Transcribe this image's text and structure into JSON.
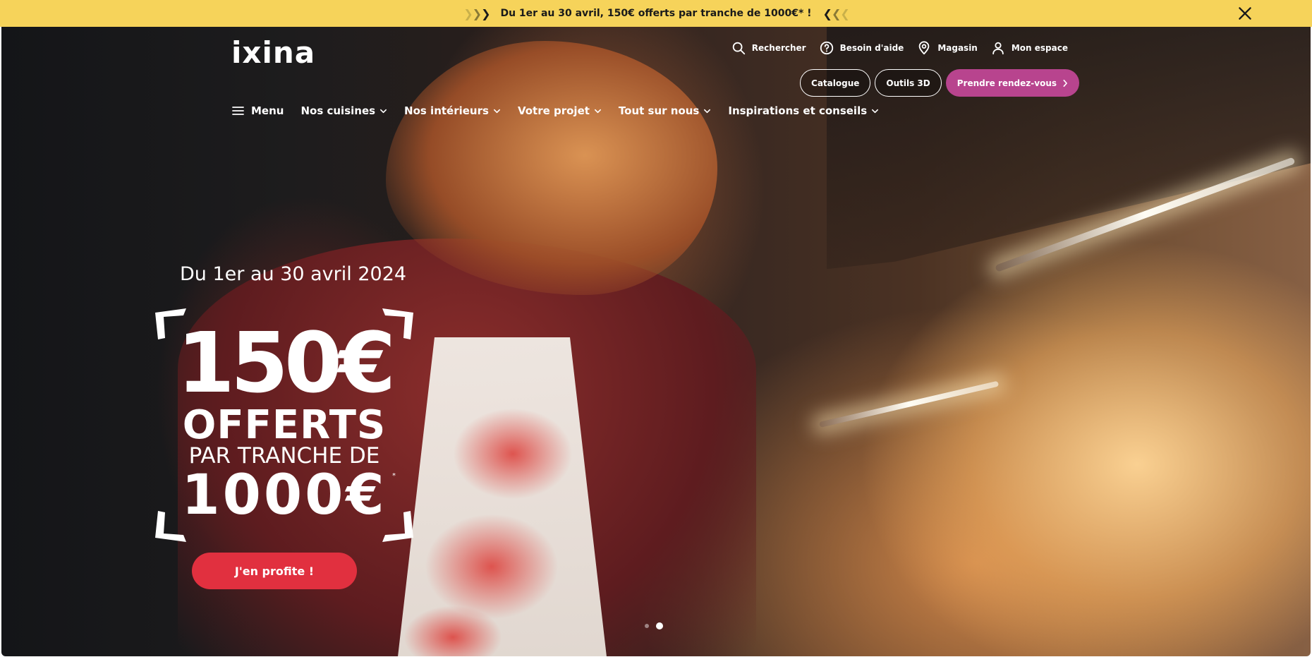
{
  "promo_bar": {
    "text": "Du 1er au 30 avril, 150€ offerts par tranche de 1000€* !",
    "chevrons_left": "❯❯❯",
    "chevrons_right": "❮❮❮",
    "background": "#f6d35a",
    "close_icon": "close-icon"
  },
  "header": {
    "logo": "ixina",
    "utility_links": [
      {
        "label": "Rechercher",
        "icon": "search-icon"
      },
      {
        "label": "Besoin d'aide",
        "icon": "help-icon"
      },
      {
        "label": "Magasin",
        "icon": "location-pin-icon"
      },
      {
        "label": "Mon espace",
        "icon": "user-icon"
      }
    ],
    "cta_buttons": [
      {
        "label": "Catalogue",
        "style": "outline"
      },
      {
        "label": "Outils 3D",
        "style": "outline"
      },
      {
        "label": "Prendre rendez-vous",
        "style": "filled",
        "color": "#b8448e"
      }
    ],
    "menu_label": "Menu",
    "nav_items": [
      {
        "label": "Nos cuisines"
      },
      {
        "label": "Nos intérieurs"
      },
      {
        "label": "Votre projet"
      },
      {
        "label": "Tout sur nous"
      },
      {
        "label": "Inspirations et conseils"
      }
    ]
  },
  "hero": {
    "date_range": "Du 1er au 30 avril 2024",
    "amount": "150€",
    "offerts": "OFFERTS",
    "par_tranche": "PAR TRANCHE DE",
    "threshold": "1000€",
    "asterisk": "*",
    "cta_label": "J'en profite !",
    "cta_color": "#e1303f",
    "slides_count": 2,
    "active_slide": 2
  }
}
